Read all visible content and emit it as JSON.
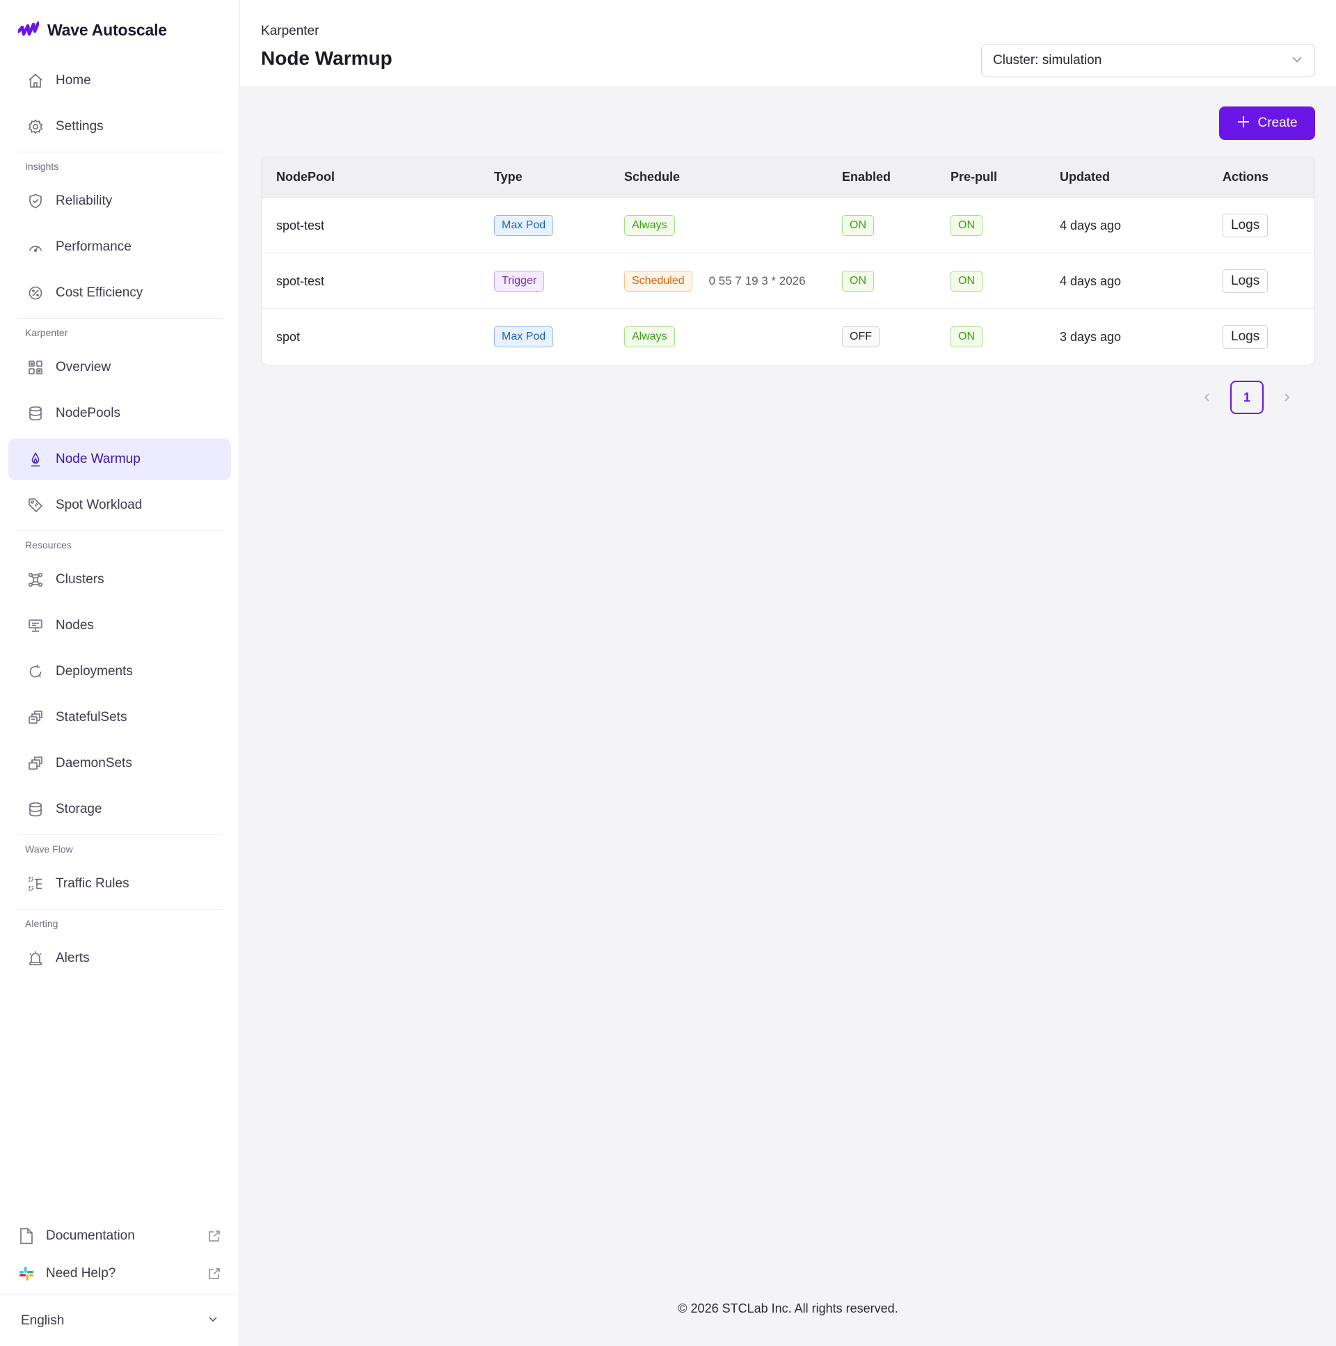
{
  "brand": {
    "name": "Wave Autoscale"
  },
  "sidebar": {
    "items_top": [
      {
        "label": "Home",
        "icon": "home-icon"
      },
      {
        "label": "Settings",
        "icon": "gear-icon"
      }
    ],
    "sections": [
      {
        "title": "Insights",
        "items": [
          {
            "label": "Reliability",
            "icon": "shield-icon"
          },
          {
            "label": "Performance",
            "icon": "gauge-icon"
          },
          {
            "label": "Cost Efficiency",
            "icon": "cost-icon"
          }
        ]
      },
      {
        "title": "Karpenter",
        "items": [
          {
            "label": "Overview",
            "icon": "grid-icon"
          },
          {
            "label": "NodePools",
            "icon": "database-icon"
          },
          {
            "label": "Node Warmup",
            "icon": "flame-icon",
            "active": true
          },
          {
            "label": "Spot Workload",
            "icon": "tag-icon"
          }
        ]
      },
      {
        "title": "Resources",
        "items": [
          {
            "label": "Clusters",
            "icon": "cluster-icon"
          },
          {
            "label": "Nodes",
            "icon": "node-icon"
          },
          {
            "label": "Deployments",
            "icon": "refresh-icon"
          },
          {
            "label": "StatefulSets",
            "icon": "stack-icon"
          },
          {
            "label": "DaemonSets",
            "icon": "stack-icon"
          },
          {
            "label": "Storage",
            "icon": "database-icon"
          }
        ]
      },
      {
        "title": "Wave Flow",
        "items": [
          {
            "label": "Traffic Rules",
            "icon": "flow-icon"
          }
        ]
      },
      {
        "title": "Alerting",
        "items": [
          {
            "label": "Alerts",
            "icon": "siren-icon"
          }
        ]
      }
    ],
    "documentation": "Documentation",
    "need_help": "Need Help?",
    "language": "English"
  },
  "header": {
    "breadcrumb": "Karpenter",
    "title": "Node Warmup",
    "cluster_select": "Cluster: simulation"
  },
  "toolbar": {
    "create_label": "Create"
  },
  "table": {
    "columns": [
      "NodePool",
      "Type",
      "Schedule",
      "Enabled",
      "Pre-pull",
      "Updated",
      "Actions"
    ],
    "rows": [
      {
        "nodepool": "spot-test",
        "type": "Max Pod",
        "type_color": "blue",
        "schedule": "Always",
        "schedule_color": "green",
        "cron": "",
        "enabled": "ON",
        "prepull": "ON",
        "updated": "4 days ago",
        "action": "Logs"
      },
      {
        "nodepool": "spot-test",
        "type": "Trigger",
        "type_color": "purple",
        "schedule": "Scheduled",
        "schedule_color": "orange",
        "cron": "0 55 7 19 3 * 2026",
        "enabled": "ON",
        "prepull": "ON",
        "updated": "4 days ago",
        "action": "Logs"
      },
      {
        "nodepool": "spot",
        "type": "Max Pod",
        "type_color": "blue",
        "schedule": "Always",
        "schedule_color": "green",
        "cron": "",
        "enabled": "OFF",
        "prepull": "ON",
        "updated": "3 days ago",
        "action": "Logs"
      }
    ]
  },
  "pagination": {
    "current_page": "1"
  },
  "footer": {
    "copyright": "© 2026 STCLab Inc. All rights reserved."
  },
  "colors": {
    "accent": "#6a16e6",
    "active_bg": "#ecebff",
    "active_text": "#3a16a6"
  }
}
